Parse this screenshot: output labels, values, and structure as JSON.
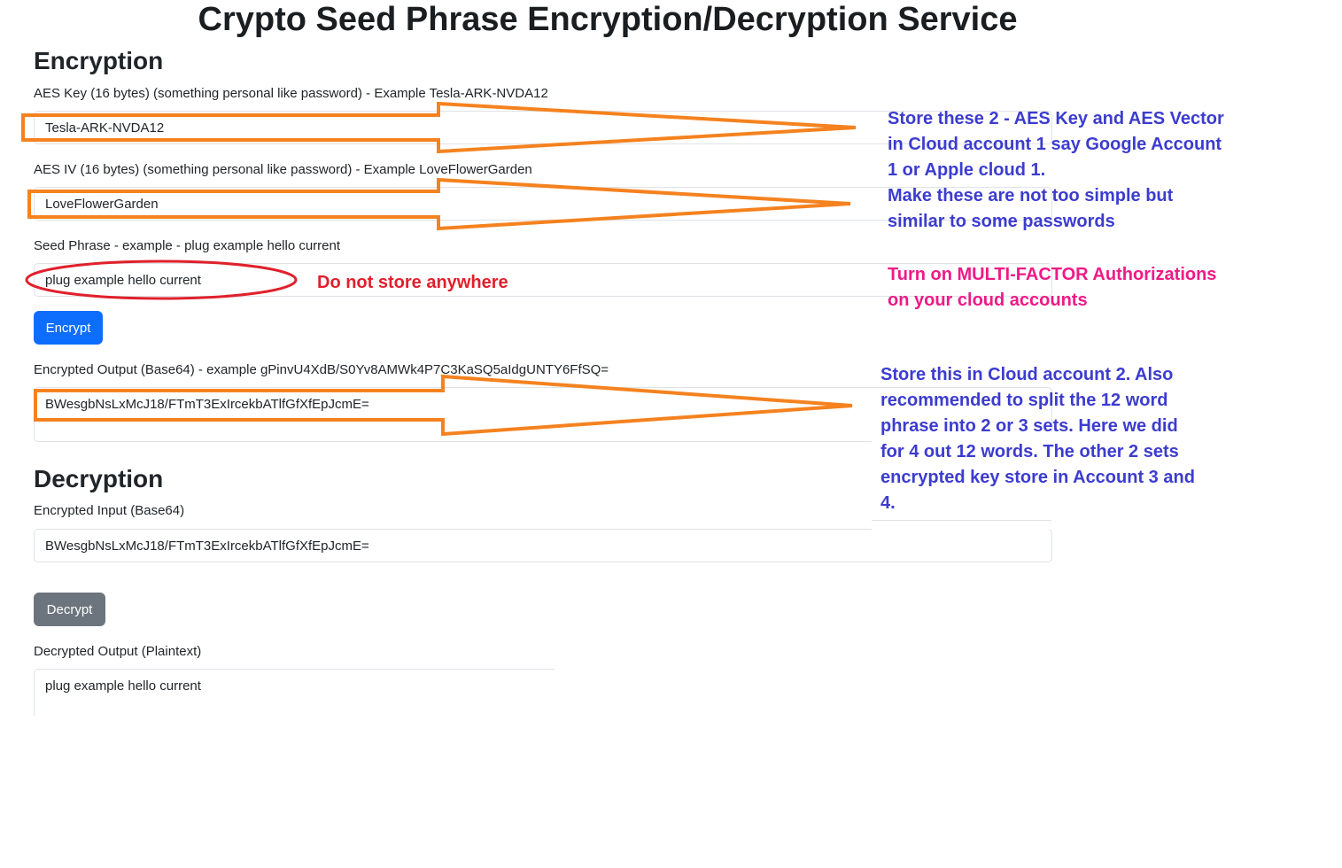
{
  "page": {
    "title": "Crypto Seed Phrase Encryption/Decryption Service"
  },
  "encryption": {
    "heading": "Encryption",
    "aes_key": {
      "label": "AES Key (16 bytes) (something personal like password) - Example Tesla-ARK-NVDA12",
      "value": "Tesla-ARK-NVDA12"
    },
    "aes_iv": {
      "label": "AES IV (16 bytes) (something personal like password) - Example LoveFlowerGarden",
      "value": "LoveFlowerGarden"
    },
    "seed_phrase": {
      "label": "Seed Phrase - example - plug example hello current",
      "value": "plug example hello current"
    },
    "encrypt_button": "Encrypt",
    "output": {
      "label": "Encrypted Output (Base64) - example gPinvU4XdB/S0Yv8AMWk4P7C3KaSQ5aIdgUNTY6FfSQ=",
      "value": "BWesgbNsLxMcJ18/FTmT3ExIrcekbATlfGfXfEpJcmE="
    }
  },
  "decryption": {
    "heading": "Decryption",
    "input": {
      "label": "Encrypted Input (Base64)",
      "value": "BWesgbNsLxMcJ18/FTmT3ExIrcekbATlfGfXfEpJcmE="
    },
    "decrypt_button": "Decrypt",
    "output": {
      "label": "Decrypted Output (Plaintext)",
      "value": "plug example hello current"
    }
  },
  "annotations": {
    "store_keys_note": "Store these 2 - AES Key and AES Vector\nin Cloud account 1 say Google Account\n1 or Apple cloud 1.\nMake these are not too simple but\nsimilar to some passwords",
    "mfa_note": "Turn on MULTI-FACTOR Authorizations\non your cloud accounts",
    "do_not_store_note": "Do not store anywhere",
    "store_output_note": "Store this in Cloud account 2. Also\nrecommended to split the 12 word\nphrase into 2 or 3 sets. Here we did\nfor 4 out 12 words. The other 2 sets\nencrypted key store in Account 3 and\n4."
  },
  "colors": {
    "arrow": "#f5821f",
    "circle": "#e0202b",
    "note_blue": "#3c3ccf",
    "note_pink": "#ee1a86",
    "note_red": "#e0202b",
    "primary_button": "#0d6efd",
    "secondary_button": "#6c757d"
  }
}
